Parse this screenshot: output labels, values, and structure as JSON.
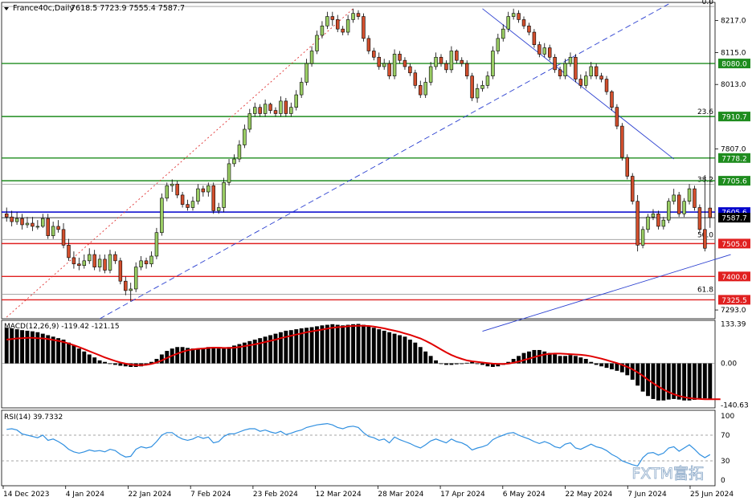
{
  "header": {
    "symbol_label": "France40c,Daily",
    "ohlc": "7618.5 7723.9 7555.4 7587.7"
  },
  "watermark": "FXTM富拓",
  "colors": {
    "bull": "#9acd64",
    "bear": "#d24f2d",
    "macd_hist": "#000000",
    "macd_signal": "#e00000",
    "rsi_line": "#2f8fe0",
    "support_green": "#1e8c1e",
    "red_level": "#e02020",
    "blue_level": "#0000cc",
    "fib_line": "#999999"
  },
  "chart_data": [
    {
      "type": "candlestick",
      "name": "price",
      "x_labels": [
        "14 Dec 2023",
        "4 Jan 2024",
        "22 Jan 2024",
        "7 Feb 2024",
        "23 Feb 2024",
        "12 Mar 2024",
        "28 Mar 2024",
        "17 Apr 2024",
        "6 May 2024",
        "22 May 2024",
        "7 Jun 2024",
        "25 Jun 2024"
      ],
      "y_ticks": [
        "8217.0",
        "8115.0",
        "8013.0",
        "7807.0",
        "7293.0"
      ],
      "ylim": [
        7265,
        8275
      ],
      "close": [
        7590,
        7575,
        7585,
        7565,
        7570,
        7560,
        7560,
        7585,
        7530,
        7560,
        7550,
        7500,
        7460,
        7440,
        7435,
        7450,
        7470,
        7430,
        7455,
        7420,
        7470,
        7450,
        7385,
        7355,
        7360,
        7430,
        7450,
        7440,
        7465,
        7540,
        7650,
        7690,
        7695,
        7660,
        7630,
        7620,
        7640,
        7680,
        7670,
        7690,
        7610,
        7620,
        7700,
        7760,
        7775,
        7820,
        7870,
        7920,
        7940,
        7920,
        7950,
        7930,
        7920,
        7960,
        7920,
        7940,
        7980,
        8020,
        8080,
        8120,
        8170,
        8200,
        8230,
        8220,
        8190,
        8180,
        8220,
        8240,
        8230,
        8160,
        8120,
        8100,
        8070,
        8080,
        8040,
        8110,
        8090,
        8070,
        8050,
        8010,
        7980,
        8020,
        8070,
        8100,
        8080,
        8060,
        8120,
        8090,
        8080,
        8040,
        7970,
        8000,
        8010,
        8040,
        8120,
        8160,
        8190,
        8230,
        8240,
        8220,
        8200,
        8180,
        8140,
        8110,
        8130,
        8100,
        8060,
        8040,
        8080,
        8100,
        8030,
        8010,
        8040,
        8070,
        8040,
        8030,
        7990,
        7940,
        7880,
        7780,
        7720,
        7640,
        7500,
        7550,
        7590,
        7600,
        7560,
        7580,
        7640,
        7660,
        7600,
        7640,
        7680,
        7620,
        7550,
        7490,
        7588
      ],
      "open": [
        7600,
        7590,
        7575,
        7585,
        7565,
        7570,
        7560,
        7560,
        7585,
        7530,
        7560,
        7550,
        7500,
        7460,
        7440,
        7435,
        7450,
        7470,
        7430,
        7455,
        7420,
        7470,
        7450,
        7385,
        7355,
        7360,
        7430,
        7450,
        7440,
        7465,
        7540,
        7650,
        7690,
        7695,
        7660,
        7630,
        7620,
        7640,
        7680,
        7670,
        7690,
        7610,
        7620,
        7700,
        7760,
        7775,
        7820,
        7870,
        7920,
        7940,
        7920,
        7950,
        7930,
        7920,
        7960,
        7920,
        7940,
        7980,
        8020,
        8080,
        8120,
        8170,
        8200,
        8230,
        8220,
        8190,
        8180,
        8220,
        8240,
        8230,
        8160,
        8120,
        8100,
        8070,
        8080,
        8040,
        8110,
        8090,
        8070,
        8050,
        8010,
        7980,
        8020,
        8070,
        8100,
        8080,
        8060,
        8120,
        8090,
        8080,
        8040,
        7970,
        8000,
        8010,
        8040,
        8120,
        8160,
        8190,
        8230,
        8240,
        8220,
        8200,
        8180,
        8140,
        8110,
        8130,
        8100,
        8060,
        8040,
        8080,
        8100,
        8030,
        8010,
        8040,
        8070,
        8040,
        8030,
        7990,
        7940,
        7880,
        7780,
        7720,
        7640,
        7500,
        7550,
        7590,
        7600,
        7560,
        7580,
        7640,
        7660,
        7600,
        7640,
        7680,
        7620,
        7550,
        7618.5
      ],
      "high": [
        7620,
        7610,
        7605,
        7600,
        7590,
        7590,
        7580,
        7600,
        7600,
        7575,
        7580,
        7570,
        7520,
        7480,
        7460,
        7470,
        7490,
        7485,
        7470,
        7470,
        7485,
        7480,
        7460,
        7400,
        7380,
        7445,
        7465,
        7460,
        7480,
        7555,
        7665,
        7700,
        7710,
        7705,
        7670,
        7645,
        7655,
        7695,
        7690,
        7700,
        7700,
        7635,
        7715,
        7775,
        7790,
        7835,
        7885,
        7935,
        7955,
        7950,
        7965,
        7955,
        7940,
        7975,
        7970,
        7955,
        7995,
        8035,
        8095,
        8135,
        8185,
        8215,
        8245,
        8245,
        8235,
        8200,
        8235,
        8255,
        8250,
        8240,
        8170,
        8130,
        8115,
        8095,
        8090,
        8125,
        8120,
        8100,
        8080,
        8060,
        8025,
        8035,
        8085,
        8115,
        8110,
        8090,
        8135,
        8125,
        8100,
        8090,
        8050,
        8015,
        8025,
        8055,
        8135,
        8175,
        8205,
        8245,
        8255,
        8250,
        8230,
        8210,
        8190,
        8150,
        8145,
        8140,
        8110,
        8070,
        8095,
        8115,
        8110,
        8045,
        8055,
        8085,
        8080,
        8050,
        8040,
        7995,
        7950,
        7890,
        7790,
        7730,
        7660,
        7560,
        7600,
        7615,
        7610,
        7590,
        7650,
        7680,
        7670,
        7650,
        7695,
        7690,
        7630,
        7723.9
      ],
      "low": [
        7575,
        7560,
        7565,
        7550,
        7555,
        7545,
        7550,
        7555,
        7520,
        7520,
        7540,
        7490,
        7450,
        7425,
        7420,
        7425,
        7440,
        7420,
        7415,
        7410,
        7410,
        7440,
        7375,
        7340,
        7320,
        7350,
        7420,
        7425,
        7430,
        7455,
        7530,
        7640,
        7670,
        7650,
        7620,
        7610,
        7610,
        7630,
        7655,
        7655,
        7600,
        7600,
        7605,
        7690,
        7750,
        7765,
        7810,
        7860,
        7910,
        7910,
        7910,
        7920,
        7910,
        7910,
        7910,
        7910,
        7930,
        7970,
        8010,
        8070,
        8110,
        8160,
        8190,
        8200,
        8180,
        8170,
        8170,
        8210,
        8220,
        8150,
        8110,
        8090,
        8060,
        8060,
        8030,
        8030,
        8080,
        8060,
        8040,
        8000,
        7970,
        7970,
        8010,
        8060,
        8070,
        8050,
        8050,
        8080,
        8070,
        8030,
        7960,
        7955,
        7990,
        8000,
        8030,
        8110,
        8150,
        8180,
        8220,
        8210,
        8190,
        8170,
        8130,
        8100,
        8100,
        8090,
        8050,
        8030,
        8030,
        8070,
        8020,
        8000,
        8000,
        8030,
        8030,
        8020,
        7980,
        7930,
        7870,
        7770,
        7710,
        7630,
        7480,
        7490,
        7540,
        7580,
        7550,
        7550,
        7570,
        7630,
        7590,
        7590,
        7630,
        7610,
        7540,
        7480,
        7555.4
      ]
    },
    {
      "type": "histogram",
      "name": "macd",
      "label": "MACD(12,26,9) -119.42 -121.15",
      "y_ticks": [
        "133.39",
        "0.00",
        "-140.63"
      ],
      "ylim": [
        -150,
        145
      ],
      "values": [
        120,
        118,
        115,
        112,
        110,
        108,
        105,
        100,
        95,
        90,
        85,
        80,
        70,
        60,
        50,
        40,
        30,
        20,
        10,
        5,
        0,
        -5,
        -8,
        -10,
        -12,
        -12,
        -10,
        -5,
        5,
        15,
        30,
        42,
        50,
        55,
        55,
        52,
        50,
        50,
        52,
        55,
        55,
        50,
        50,
        55,
        60,
        65,
        70,
        75,
        80,
        85,
        90,
        95,
        100,
        105,
        110,
        112,
        115,
        118,
        120,
        122,
        125,
        128,
        130,
        132,
        130,
        128,
        130,
        132,
        133,
        130,
        125,
        120,
        115,
        110,
        105,
        100,
        95,
        90,
        80,
        70,
        55,
        40,
        25,
        10,
        0,
        -5,
        -5,
        -3,
        0,
        2,
        5,
        0,
        -5,
        -10,
        -12,
        -10,
        -5,
        5,
        15,
        25,
        35,
        40,
        45,
        45,
        40,
        35,
        30,
        25,
        25,
        28,
        25,
        20,
        15,
        5,
        -5,
        -10,
        -15,
        -20,
        -25,
        -30,
        -40,
        -55,
        -75,
        -95,
        -110,
        -120,
        -125,
        -125,
        -122,
        -120,
        -122,
        -125,
        -125,
        -123,
        -120,
        -118,
        -119.42
      ],
      "signal": [
        80,
        82,
        84,
        85,
        86,
        86,
        85,
        84,
        82,
        79,
        76,
        72,
        67,
        61,
        55,
        48,
        41,
        34,
        27,
        20,
        14,
        8,
        3,
        -1,
        -4,
        -6,
        -6,
        -5,
        -2,
        3,
        10,
        18,
        26,
        33,
        39,
        44,
        47,
        49,
        50,
        52,
        53,
        53,
        52,
        52,
        53,
        55,
        58,
        61,
        64,
        68,
        72,
        76,
        80,
        85,
        89,
        93,
        97,
        101,
        105,
        108,
        111,
        114,
        117,
        120,
        122,
        123,
        125,
        126,
        127,
        127,
        126,
        124,
        121,
        118,
        114,
        110,
        106,
        101,
        96,
        90,
        84,
        76,
        67,
        57,
        47,
        37,
        28,
        21,
        15,
        10,
        7,
        5,
        3,
        1,
        -1,
        -2,
        -2,
        -1,
        2,
        6,
        11,
        16,
        21,
        26,
        30,
        32,
        33,
        33,
        32,
        31,
        30,
        29,
        27,
        24,
        20,
        16,
        11,
        6,
        1,
        -5,
        -12,
        -20,
        -30,
        -42,
        -55,
        -67,
        -78,
        -88,
        -97,
        -104,
        -110,
        -114,
        -117,
        -119,
        -120,
        -121,
        -121,
        -121,
        -121.15
      ]
    },
    {
      "type": "line",
      "name": "rsi",
      "label": "RSI(14) 39.7332",
      "y_ticks": [
        "100",
        "70",
        "30",
        "0"
      ],
      "ylim": [
        0,
        100
      ],
      "values": [
        79,
        80,
        78,
        72,
        70,
        68,
        66,
        70,
        62,
        64,
        60,
        55,
        48,
        44,
        42,
        44,
        47,
        45,
        46,
        44,
        48,
        46,
        40,
        36,
        37,
        48,
        52,
        50,
        52,
        60,
        70,
        74,
        74,
        68,
        64,
        62,
        64,
        68,
        65,
        67,
        58,
        60,
        68,
        72,
        72,
        75,
        78,
        80,
        80,
        76,
        78,
        75,
        73,
        76,
        71,
        73,
        76,
        78,
        82,
        84,
        86,
        87,
        88,
        86,
        82,
        80,
        83,
        84,
        82,
        74,
        68,
        66,
        62,
        64,
        58,
        67,
        63,
        60,
        57,
        53,
        50,
        55,
        61,
        64,
        61,
        58,
        64,
        60,
        58,
        54,
        47,
        50,
        52,
        55,
        63,
        67,
        70,
        73,
        74,
        70,
        67,
        64,
        60,
        57,
        60,
        57,
        52,
        50,
        56,
        58,
        50,
        48,
        52,
        56,
        52,
        50,
        46,
        40,
        36,
        30,
        27,
        24,
        22,
        35,
        42,
        43,
        39,
        42,
        50,
        52,
        45,
        50,
        55,
        48,
        40,
        35,
        39.73
      ]
    }
  ],
  "levels": [
    {
      "label": "8080.0",
      "value": 8080.0,
      "kind": "green"
    },
    {
      "label": "7910.7",
      "value": 7910.7,
      "kind": "green"
    },
    {
      "label": "7778.2",
      "value": 7778.2,
      "kind": "green"
    },
    {
      "label": "7705.6",
      "value": 7705.6,
      "kind": "green"
    },
    {
      "label": "7605.6",
      "value": 7605.6,
      "kind": "blue"
    },
    {
      "label": "7587.7",
      "value": 7587.7,
      "kind": "current"
    },
    {
      "label": "7505.0",
      "value": 7505.0,
      "kind": "red"
    },
    {
      "label": "7400.0",
      "value": 7400.0,
      "kind": "red"
    },
    {
      "label": "7325.5",
      "value": 7325.5,
      "kind": "red"
    }
  ],
  "fib_levels": [
    {
      "label": "0.0",
      "value": 8262
    },
    {
      "label": "23.6",
      "value": 7911
    },
    {
      "label": "38.2",
      "value": 7694
    },
    {
      "label": "50.0",
      "value": 7518
    },
    {
      "label": "61.8",
      "value": 7343
    }
  ],
  "trendlines": [
    {
      "kind": "dashed",
      "from": [
        18,
        7265
      ],
      "to": [
        128,
        8270
      ]
    },
    {
      "kind": "solid",
      "from": [
        92,
        7225
      ],
      "to": [
        140,
        7470
      ]
    },
    {
      "kind": "dotted",
      "from": [
        0,
        7270
      ],
      "to": [
        67,
        8255
      ]
    },
    {
      "kind": "solid",
      "from": [
        92,
        8255
      ],
      "to": [
        129,
        7775
      ]
    }
  ]
}
